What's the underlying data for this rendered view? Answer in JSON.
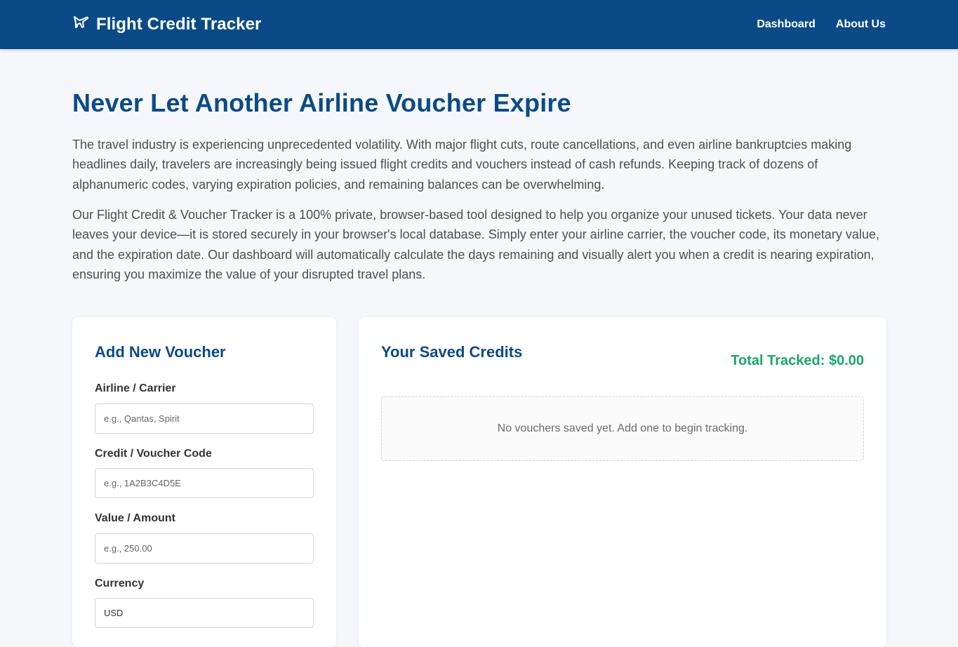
{
  "header": {
    "brand": "Flight Credit Tracker",
    "brand_icon": "airplane-icon",
    "nav": [
      {
        "label": "Dashboard"
      },
      {
        "label": "About Us"
      }
    ]
  },
  "intro": {
    "title": "Never Let Another Airline Voucher Expire",
    "paragraphs": [
      "The travel industry is experiencing unprecedented volatility. With major flight cuts, route cancellations, and even airline bankruptcies making headlines daily, travelers are increasingly being issued flight credits and vouchers instead of cash refunds. Keeping track of dozens of alphanumeric codes, varying expiration policies, and remaining balances can be overwhelming.",
      "Our Flight Credit & Voucher Tracker is a 100% private, browser-based tool designed to help you organize your unused tickets. Your data never leaves your device—it is stored securely in your browser's local database. Simply enter your airline carrier, the voucher code, its monetary value, and the expiration date. Our dashboard will automatically calculate the days remaining and visually alert you when a credit is nearing expiration, ensuring you maximize the value of your disrupted travel plans."
    ]
  },
  "form": {
    "title": "Add New Voucher",
    "fields": [
      {
        "label": "Airline / Carrier",
        "placeholder": "e.g., Qantas, Spirit",
        "value": ""
      },
      {
        "label": "Credit / Voucher Code",
        "placeholder": "e.g., 1A2B3C4D5E",
        "value": ""
      },
      {
        "label": "Value / Amount",
        "placeholder": "e.g., 250.00",
        "value": ""
      },
      {
        "label": "Currency",
        "placeholder": "",
        "value": "USD"
      }
    ]
  },
  "saved": {
    "title": "Your Saved Credits",
    "total": "Total Tracked: $0.00",
    "empty_message": "No vouchers saved yet. Add one to begin tracking."
  },
  "colors": {
    "primary": "#0a4b87",
    "accent_green": "#18a869",
    "background": "#f5f7fb"
  }
}
